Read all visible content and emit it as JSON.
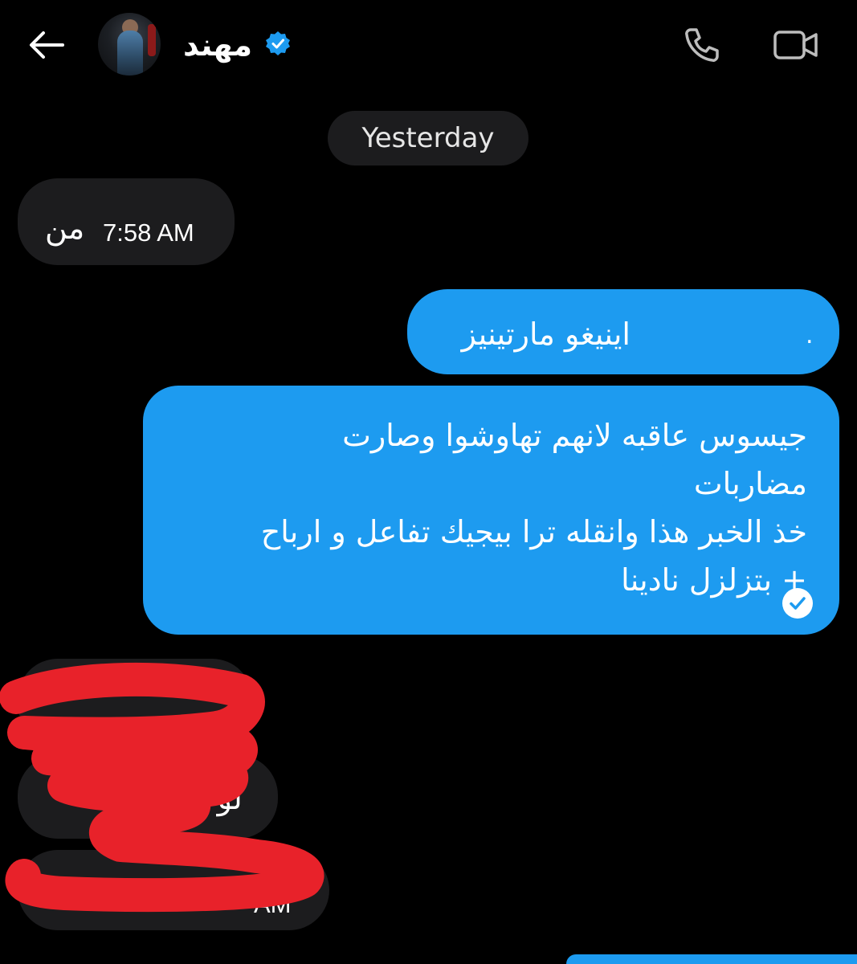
{
  "header": {
    "back_icon": "arrow-left-icon",
    "contact_name": "مهند",
    "verified_icon": "verified-badge-icon",
    "call_icon": "phone-icon",
    "video_icon": "video-camera-icon"
  },
  "date_divider": "Yesterday",
  "messages": [
    {
      "direction": "incoming",
      "text": "من",
      "time": "7:58 AM"
    },
    {
      "direction": "outgoing",
      "text": "اينيغو مارتينيز",
      "suffix": "."
    },
    {
      "direction": "outgoing",
      "text": "جيسوس عاقبه لانهم تهاوشوا وصارت\nمضاربات\nخذ الخبر هذا وانقله ترا بيجيك تفاعل و ارباح\n+ بتزلزل نادينا",
      "status_icon": "read-check-icon"
    },
    {
      "direction": "incoming",
      "text": "",
      "redacted": true
    },
    {
      "direction": "incoming",
      "text": "لو ا",
      "redacted": true
    },
    {
      "direction": "incoming",
      "text": "",
      "time": "AM",
      "redacted": true
    }
  ],
  "colors": {
    "background": "#000000",
    "incoming_bubble": "#1c1c1e",
    "outgoing_bubble": "#1d9bf0",
    "redaction": "#e8222a"
  }
}
